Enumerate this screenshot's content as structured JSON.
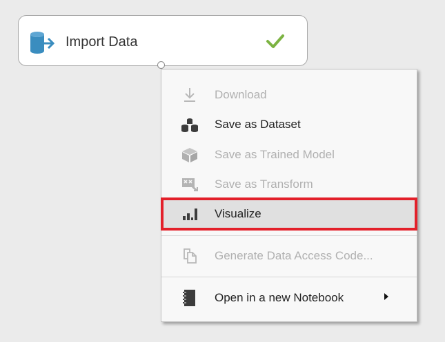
{
  "module": {
    "title": "Import Data",
    "status": "completed"
  },
  "menu": {
    "items": [
      {
        "label": "Download",
        "icon": "download-icon",
        "enabled": false
      },
      {
        "label": "Save as Dataset",
        "icon": "dataset-icon",
        "enabled": true
      },
      {
        "label": "Save as Trained Model",
        "icon": "cube-icon",
        "enabled": false
      },
      {
        "label": "Save as Transform",
        "icon": "transform-icon",
        "enabled": false
      },
      {
        "label": "Visualize",
        "icon": "bar-chart-icon",
        "enabled": true,
        "highlighted": true
      },
      {
        "label": "Generate Data Access Code...",
        "icon": "document-copy-icon",
        "enabled": false
      },
      {
        "label": "Open in a new Notebook",
        "icon": "notebook-icon",
        "enabled": true,
        "has_submenu": true
      }
    ]
  },
  "colors": {
    "canvas": "#ebebeb",
    "module_icon": "#3a8dbf",
    "check": "#7cb342",
    "highlight_border": "#e3202a",
    "disabled_text": "#b0b0b0"
  }
}
